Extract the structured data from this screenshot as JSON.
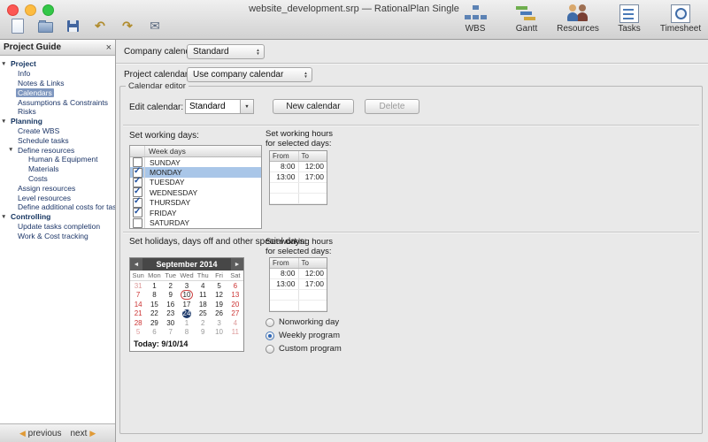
{
  "window": {
    "title": "website_development.srp — RationalPlan Single"
  },
  "toolbar": {
    "left_icons": [
      {
        "name": "new-document"
      },
      {
        "name": "open-folder"
      },
      {
        "name": "save"
      },
      {
        "name": "undo",
        "glyph": "↶"
      },
      {
        "name": "redo",
        "glyph": "↷"
      },
      {
        "name": "email",
        "glyph": "✉"
      }
    ],
    "right_items": [
      {
        "name": "wbs",
        "label": "WBS"
      },
      {
        "name": "gantt",
        "label": "Gantt"
      },
      {
        "name": "resources",
        "label": "Resources"
      },
      {
        "name": "tasks",
        "label": "Tasks"
      },
      {
        "name": "timesheet",
        "label": "Timesheet"
      }
    ]
  },
  "sidebar": {
    "title": "Project Guide",
    "close_glyph": "×",
    "twisty_glyph": "▼",
    "tree": [
      {
        "label": "Project",
        "level": 0,
        "expanded": true
      },
      {
        "label": "Info",
        "level": 1
      },
      {
        "label": "Notes & Links",
        "level": 1
      },
      {
        "label": "Calendars",
        "level": 1,
        "selected": true
      },
      {
        "label": "Assumptions & Constraints",
        "level": 1
      },
      {
        "label": "Risks",
        "level": 1
      },
      {
        "label": "Planning",
        "level": 0,
        "expanded": true
      },
      {
        "label": "Create WBS",
        "level": 1
      },
      {
        "label": "Schedule tasks",
        "level": 1
      },
      {
        "label": "Define resources",
        "level": 1,
        "expanded": true
      },
      {
        "label": "Human & Equipment",
        "level": 2
      },
      {
        "label": "Materials",
        "level": 2
      },
      {
        "label": "Costs",
        "level": 2
      },
      {
        "label": "Assign resources",
        "level": 1
      },
      {
        "label": "Level resources",
        "level": 1
      },
      {
        "label": "Define additional costs for tasks",
        "level": 1
      },
      {
        "label": "Controlling",
        "level": 0,
        "expanded": true
      },
      {
        "label": "Update tasks completion",
        "level": 1
      },
      {
        "label": "Work & Cost tracking",
        "level": 1
      }
    ],
    "footer": {
      "previous": "previous",
      "next": "next",
      "arrow_glyph": "▶"
    }
  },
  "main": {
    "company_calendar": {
      "label": "Company calendar:",
      "value": "Standard"
    },
    "project_calendar": {
      "label": "Project calendar:",
      "value": "Use company calendar"
    },
    "calendar_editor": {
      "legend": "Calendar editor",
      "edit_calendar": {
        "label": "Edit calendar:",
        "value": "Standard"
      },
      "new_calendar_button": "New calendar",
      "delete_button": "Delete",
      "working_days": {
        "label": "Set working days:",
        "header": "Week days",
        "days": [
          {
            "name": "SUNDAY",
            "checked": false
          },
          {
            "name": "MONDAY",
            "checked": true,
            "selected": true
          },
          {
            "name": "TUESDAY",
            "checked": true
          },
          {
            "name": "WEDNESDAY",
            "checked": true
          },
          {
            "name": "THURSDAY",
            "checked": true
          },
          {
            "name": "FRIDAY",
            "checked": true
          },
          {
            "name": "SATURDAY",
            "checked": false
          }
        ]
      },
      "working_hours_label": "Set working hours\nfor selected days:",
      "hours_table": {
        "headers": [
          "From",
          "To"
        ],
        "rows": [
          [
            "8:00",
            "12:00"
          ],
          [
            "13:00",
            "17:00"
          ]
        ]
      },
      "holidays_label": "Set holidays, days off and other special days:",
      "mini_calendar": {
        "month": "September",
        "year": "2014",
        "prev_glyph": "◄",
        "next_glyph": "►",
        "day_names": [
          "Sun",
          "Mon",
          "Tue",
          "Wed",
          "Thu",
          "Fri",
          "Sat"
        ],
        "weeks": [
          [
            {
              "d": 31,
              "o": 1
            },
            {
              "d": 1
            },
            {
              "d": 2
            },
            {
              "d": 3
            },
            {
              "d": 4
            },
            {
              "d": 5
            },
            {
              "d": 6
            }
          ],
          [
            {
              "d": 7
            },
            {
              "d": 8
            },
            {
              "d": 9
            },
            {
              "d": 10,
              "today": 1
            },
            {
              "d": 11
            },
            {
              "d": 12
            },
            {
              "d": 13
            }
          ],
          [
            {
              "d": 14
            },
            {
              "d": 15
            },
            {
              "d": 16
            },
            {
              "d": 17
            },
            {
              "d": 18
            },
            {
              "d": 19
            },
            {
              "d": 20
            }
          ],
          [
            {
              "d": 21
            },
            {
              "d": 22
            },
            {
              "d": 23
            },
            {
              "d": 24,
              "sel": 1
            },
            {
              "d": 25
            },
            {
              "d": 26
            },
            {
              "d": 27
            }
          ],
          [
            {
              "d": 28
            },
            {
              "d": 29
            },
            {
              "d": 30
            },
            {
              "d": 1,
              "o": 1
            },
            {
              "d": 2,
              "o": 1
            },
            {
              "d": 3,
              "o": 1
            },
            {
              "d": 4,
              "o": 1
            }
          ],
          [
            {
              "d": 5,
              "o": 1
            },
            {
              "d": 6,
              "o": 1
            },
            {
              "d": 7,
              "o": 1
            },
            {
              "d": 8,
              "o": 1
            },
            {
              "d": 9,
              "o": 1
            },
            {
              "d": 10,
              "o": 1
            },
            {
              "d": 11,
              "o": 1
            }
          ]
        ],
        "today_label": "Today: 9/10/14"
      },
      "programs": [
        {
          "label": "Nonworking day",
          "selected": false
        },
        {
          "label": "Weekly program",
          "selected": true
        },
        {
          "label": "Custom program",
          "selected": false
        }
      ]
    }
  },
  "colors": {
    "selection_blue": "#7f97bf",
    "weekend_red": "#cc3333",
    "selected_day_navy": "#1d3a6b",
    "row_highlight": "#a9c6e8"
  }
}
